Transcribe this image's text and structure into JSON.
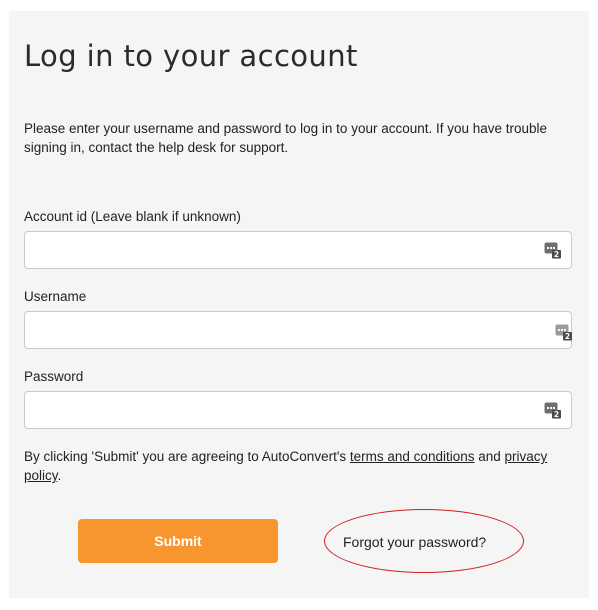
{
  "page": {
    "title": "Log in to your account",
    "intro": "Please enter your username and password to log in to your account. If you have trouble signing in, contact the help desk for support."
  },
  "fields": {
    "account_id": {
      "label": "Account id (Leave blank if unknown)",
      "value": "",
      "placeholder": ""
    },
    "username": {
      "label": "Username",
      "value": "",
      "placeholder": ""
    },
    "password": {
      "label": "Password",
      "value": "",
      "placeholder": ""
    }
  },
  "password_manager_icon": {
    "name": "password-manager-icon",
    "badge_count": "2"
  },
  "terms": {
    "prefix": "By clicking 'Submit' you are agreeing to AutoConvert's ",
    "terms_link": "terms and conditions",
    "middle": " and ",
    "privacy_link": "privacy policy",
    "suffix": "."
  },
  "actions": {
    "submit_label": "Submit",
    "forgot_label": "Forgot your password?"
  },
  "colors": {
    "panel_background": "#f5f5f5",
    "submit_button": "#f7962e",
    "annotation_circle": "#d32020"
  }
}
